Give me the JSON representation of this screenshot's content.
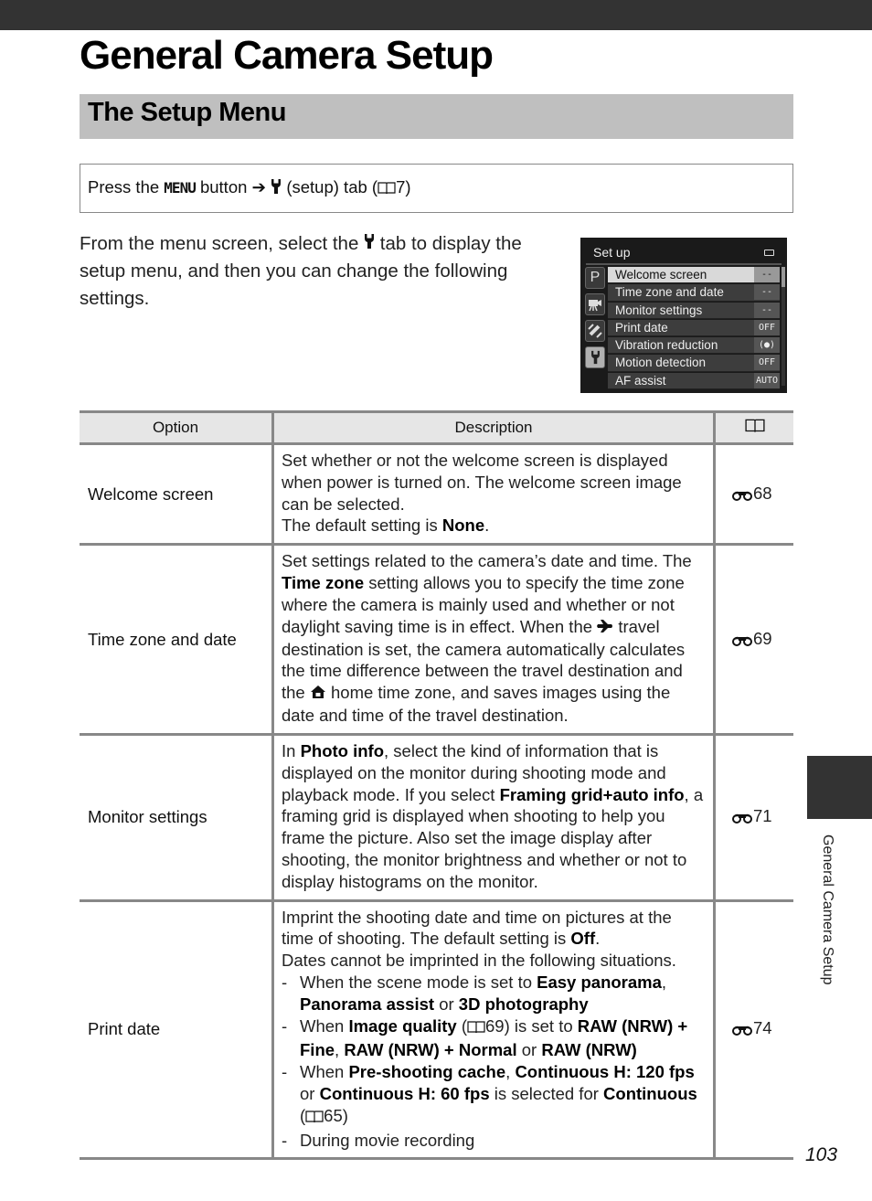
{
  "header": {
    "title": "General Camera Setup",
    "section_title": "The Setup Menu"
  },
  "navigation": {
    "prefix": "Press the",
    "menu_button": "MENU",
    "button_word": "button",
    "arrow": "➔",
    "setup_icon": "wrench-icon",
    "tab_text": "(setup) tab (",
    "page_ref_icon": "book-icon",
    "page_ref": "7",
    "suffix": ")"
  },
  "intro": {
    "before_icon": "From the menu screen, select the",
    "icon": "wrench-icon",
    "after_icon": "tab to display the setup menu, and then you can change the following settings."
  },
  "camera_screen": {
    "title": "Set up",
    "battery_icon": "battery-icon",
    "tabs": [
      {
        "name": "shooting-tab",
        "glyph": "P",
        "active": false
      },
      {
        "name": "movie-tab",
        "glyph": "movie-camera-icon",
        "active": false
      },
      {
        "name": "wireless-tab",
        "glyph": "satellite-icon",
        "active": false
      },
      {
        "name": "setup-tab",
        "glyph": "wrench-icon",
        "active": true
      }
    ],
    "items": [
      {
        "label": "Welcome screen",
        "value": "--",
        "selected": true
      },
      {
        "label": "Time zone and date",
        "value": "--",
        "selected": false
      },
      {
        "label": "Monitor settings",
        "value": "--",
        "selected": false
      },
      {
        "label": "Print date",
        "value": "OFF",
        "selected": false
      },
      {
        "label": "Vibration reduction",
        "value": "(●)",
        "selected": false
      },
      {
        "label": "Motion detection",
        "value": "OFF",
        "selected": false
      },
      {
        "label": "AF assist",
        "value": "AUTO",
        "selected": false
      }
    ]
  },
  "table": {
    "headers": {
      "option": "Option",
      "description": "Description",
      "reference_icon": "book-icon"
    },
    "rows": [
      {
        "option": "Welcome screen",
        "desc": {
          "t1": "Set whether or not the welcome screen is displayed when power is turned on. The welcome screen image can be selected.",
          "t2": "The default setting is ",
          "b1": "None",
          "t3": "."
        },
        "ref_icon": "binoculars-icon",
        "ref": "68"
      },
      {
        "option": "Time zone and date",
        "desc": {
          "t1": "Set settings related to the camera’s date and time. The ",
          "b1": "Time zone",
          "t2": " setting allows you to specify the time zone where the camera is mainly used and whether or not daylight saving time is in effect. When the ",
          "icon1": "airplane-icon",
          "t3": " travel destination is set, the camera automatically calculates the time difference between the travel destination and the ",
          "icon2": "home-icon",
          "t4": " home time zone, and saves images using the date and time of the travel destination."
        },
        "ref_icon": "binoculars-icon",
        "ref": "69"
      },
      {
        "option": "Monitor settings",
        "desc": {
          "t1": "In ",
          "b1": "Photo info",
          "t2": ", select the kind of information that is displayed on the monitor during shooting mode and playback mode. If you select ",
          "b2": "Framing grid+auto info",
          "t3": ", a framing grid is displayed when shooting to help you frame the picture. Also set the image display after shooting, the monitor brightness and whether or not to display histograms on the monitor."
        },
        "ref_icon": "binoculars-icon",
        "ref": "71"
      },
      {
        "option": "Print date",
        "desc": {
          "t1": "Imprint the shooting date and time on pictures at the time of shooting. The default setting is ",
          "b1": "Off",
          "t2": ".",
          "t3": "Dates cannot be imprinted in the following situations.",
          "situations": [
            {
              "a": "When the scene mode is set to ",
              "b": "Easy panorama",
              "c": ", ",
              "d": "Panorama assist",
              "e": " or ",
              "f": "3D photography"
            },
            {
              "a": "When ",
              "b": "Image quality",
              "c": " (",
              "ref": "69",
              "d": ") is set to ",
              "e": "RAW (NRW) + Fine",
              "f": ", ",
              "g": "RAW (NRW) + Normal",
              "h": " or ",
              "i": "RAW (NRW)"
            },
            {
              "a": "When ",
              "b": "Pre-shooting cache",
              "c": ", ",
              "d": "Continuous H: 120 fps",
              "e": " or ",
              "f": "Continuous H: 60 fps",
              "g": " is selected for ",
              "h": "Continuous",
              "i": " (",
              "ref": "65",
              "j": ")"
            },
            {
              "a": "During movie recording"
            }
          ]
        },
        "ref_icon": "binoculars-icon",
        "ref": "74"
      }
    ]
  },
  "side_tab": {
    "label": "General Camera Setup"
  },
  "footer": {
    "page_number": "103"
  }
}
